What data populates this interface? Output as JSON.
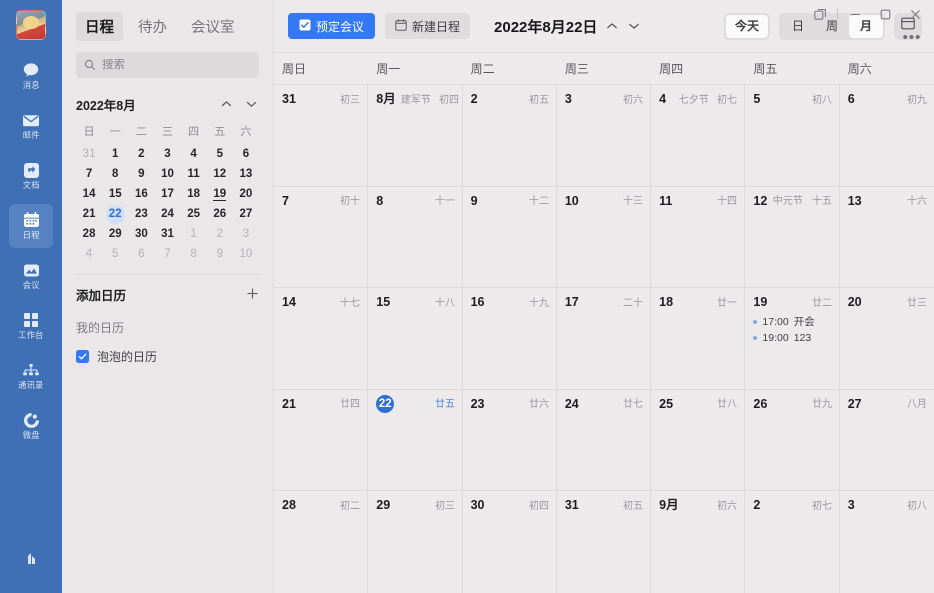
{
  "rail": {
    "avatar_alt": "user-avatar",
    "items": [
      {
        "label": "消息",
        "icon": "chat-icon",
        "active": false
      },
      {
        "label": "邮件",
        "icon": "mail-icon",
        "active": false
      },
      {
        "label": "文档",
        "icon": "doc-icon",
        "active": false
      },
      {
        "label": "日程",
        "icon": "calendar-icon",
        "active": true
      },
      {
        "label": "会议",
        "icon": "meeting-icon",
        "active": false
      },
      {
        "label": "工作台",
        "icon": "workbench-icon",
        "active": false
      },
      {
        "label": "通讯录",
        "icon": "contacts-icon",
        "active": false
      },
      {
        "label": "微盘",
        "icon": "drive-icon",
        "active": false
      }
    ],
    "bottom_icon": "stats-icon"
  },
  "tabs": [
    {
      "label": "日程",
      "active": true
    },
    {
      "label": "待办",
      "active": false
    },
    {
      "label": "会议室",
      "active": false
    }
  ],
  "search": {
    "placeholder": "搜索",
    "value": "",
    "icon": "search-icon"
  },
  "mini_calendar": {
    "title": "2022年8月",
    "prev_icon": "chevron-up-icon",
    "next_icon": "chevron-down-icon",
    "weekday_headers": [
      "日",
      "一",
      "二",
      "三",
      "四",
      "五",
      "六"
    ],
    "weeks": [
      [
        {
          "d": "31",
          "out": true
        },
        {
          "d": "1"
        },
        {
          "d": "2"
        },
        {
          "d": "3"
        },
        {
          "d": "4"
        },
        {
          "d": "5"
        },
        {
          "d": "6"
        }
      ],
      [
        {
          "d": "7"
        },
        {
          "d": "8"
        },
        {
          "d": "9"
        },
        {
          "d": "10"
        },
        {
          "d": "11"
        },
        {
          "d": "12"
        },
        {
          "d": "13"
        }
      ],
      [
        {
          "d": "14"
        },
        {
          "d": "15"
        },
        {
          "d": "16"
        },
        {
          "d": "17"
        },
        {
          "d": "18"
        },
        {
          "d": "19",
          "underline": true
        },
        {
          "d": "20"
        }
      ],
      [
        {
          "d": "21"
        },
        {
          "d": "22",
          "today": true
        },
        {
          "d": "23"
        },
        {
          "d": "24"
        },
        {
          "d": "25"
        },
        {
          "d": "26"
        },
        {
          "d": "27"
        }
      ],
      [
        {
          "d": "28"
        },
        {
          "d": "29"
        },
        {
          "d": "30"
        },
        {
          "d": "31"
        },
        {
          "d": "1",
          "out": true
        },
        {
          "d": "2",
          "out": true
        },
        {
          "d": "3",
          "out": true
        }
      ],
      [
        {
          "d": "4",
          "out": true
        },
        {
          "d": "5",
          "out": true
        },
        {
          "d": "6",
          "out": true
        },
        {
          "d": "7",
          "out": true
        },
        {
          "d": "8",
          "out": true
        },
        {
          "d": "9",
          "out": true
        },
        {
          "d": "10",
          "out": true
        }
      ]
    ]
  },
  "calendar_panel": {
    "add_label": "添加日历",
    "add_icon": "plus-icon",
    "my_calendars_label": "我的日历",
    "calendars": [
      {
        "name": "泡泡的日历",
        "checked": true,
        "color": "#3478f6"
      }
    ]
  },
  "toolbar": {
    "book_meeting_label": "预定会议",
    "book_meeting_icon": "checkbox-square-icon",
    "new_event_label": "新建日程",
    "new_event_icon": "calendar-add-icon",
    "date_title": "2022年8月22日",
    "prev_icon": "chevron-up-icon",
    "next_icon": "chevron-down-icon",
    "today_label": "今天",
    "views": [
      {
        "label": "日",
        "active": false
      },
      {
        "label": "周",
        "active": false
      },
      {
        "label": "月",
        "active": true
      }
    ],
    "panel_toggle_icon": "layout-panel-icon"
  },
  "window": {
    "popout_icon": "pop-out-icon",
    "minimize_icon": "minimize-icon",
    "maximize_icon": "maximize-icon",
    "close_icon": "close-icon",
    "more_label": "•••"
  },
  "month_view": {
    "weekday_headers": [
      "周日",
      "周一",
      "周二",
      "周三",
      "周四",
      "周五",
      "周六"
    ],
    "weeks": [
      [
        {
          "day": "31",
          "lunar": "初三"
        },
        {
          "day": "8月",
          "festival": "建军节",
          "lunar": "初四"
        },
        {
          "day": "2",
          "lunar": "初五"
        },
        {
          "day": "3",
          "lunar": "初六"
        },
        {
          "day": "4",
          "festival": "七夕节",
          "lunar": "初七"
        },
        {
          "day": "5",
          "lunar": "初八"
        },
        {
          "day": "6",
          "lunar": "初九"
        }
      ],
      [
        {
          "day": "7",
          "lunar": "初十"
        },
        {
          "day": "8",
          "lunar": "十一"
        },
        {
          "day": "9",
          "lunar": "十二"
        },
        {
          "day": "10",
          "lunar": "十三"
        },
        {
          "day": "11",
          "lunar": "十四"
        },
        {
          "day": "12",
          "festival": "中元节",
          "lunar": "十五"
        },
        {
          "day": "13",
          "lunar": "十六"
        }
      ],
      [
        {
          "day": "14",
          "lunar": "十七"
        },
        {
          "day": "15",
          "lunar": "十八"
        },
        {
          "day": "16",
          "lunar": "十九"
        },
        {
          "day": "17",
          "lunar": "二十"
        },
        {
          "day": "18",
          "lunar": "廿一"
        },
        {
          "day": "19",
          "lunar": "廿二",
          "events": [
            {
              "time": "17:00",
              "title": "开会"
            },
            {
              "time": "19:00",
              "title": "123"
            }
          ]
        },
        {
          "day": "20",
          "lunar": "廿三"
        }
      ],
      [
        {
          "day": "21",
          "lunar": "廿四"
        },
        {
          "day": "22",
          "lunar": "廿五",
          "selected": true
        },
        {
          "day": "23",
          "lunar": "廿六"
        },
        {
          "day": "24",
          "lunar": "廿七"
        },
        {
          "day": "25",
          "lunar": "廿八"
        },
        {
          "day": "26",
          "lunar": "廿九"
        },
        {
          "day": "27",
          "lunar": "八月"
        }
      ],
      [
        {
          "day": "28",
          "lunar": "初二"
        },
        {
          "day": "29",
          "lunar": "初三"
        },
        {
          "day": "30",
          "lunar": "初四"
        },
        {
          "day": "31",
          "lunar": "初五"
        },
        {
          "day": "9月",
          "lunar": "初六"
        },
        {
          "day": "2",
          "lunar": "初七"
        },
        {
          "day": "3",
          "lunar": "初八"
        }
      ]
    ]
  },
  "colors": {
    "rail_bg": "#3f6fb5",
    "accent": "#3478f6",
    "selected_day": "#2f6fd0",
    "panel_bg": "#e9e7e7",
    "grid_bg": "#eceaea",
    "border": "#dcdada"
  }
}
